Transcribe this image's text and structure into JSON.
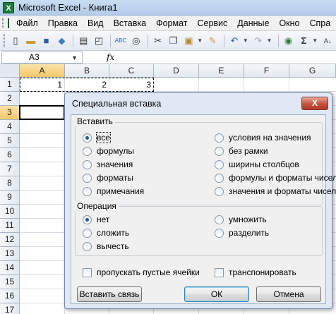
{
  "window": {
    "title": "Microsoft Excel - Книга1"
  },
  "menu": {
    "items": [
      {
        "label": "Файл"
      },
      {
        "label": "Правка"
      },
      {
        "label": "Вид"
      },
      {
        "label": "Вставка"
      },
      {
        "label": "Формат"
      },
      {
        "label": "Сервис"
      },
      {
        "label": "Данные"
      },
      {
        "label": "Окно"
      },
      {
        "label": "Спра"
      }
    ]
  },
  "formula_bar": {
    "name_box": "A3",
    "fx_label": "fx",
    "formula": ""
  },
  "sheet": {
    "columns": [
      "A",
      "B",
      "C",
      "D",
      "E",
      "F",
      "G"
    ],
    "rows": [
      "1",
      "2",
      "3",
      "4",
      "5",
      "6",
      "7",
      "8",
      "9",
      "10",
      "11",
      "12",
      "13",
      "14",
      "15",
      "16",
      "17"
    ],
    "cells": {
      "A1": "1",
      "B1": "2",
      "C1": "3"
    },
    "active_cell": "A3"
  },
  "dialog": {
    "title": "Специальная вставка",
    "close_label": "X",
    "paste_group": {
      "label": "Вставить",
      "options_left": [
        "все",
        "формулы",
        "значения",
        "форматы",
        "примечания"
      ],
      "options_right": [
        "условия на значения",
        "без рамки",
        "ширины столбцов",
        "формулы и форматы чисел",
        "значения и форматы чисел"
      ],
      "selected": "все"
    },
    "operation_group": {
      "label": "Операция",
      "options_left": [
        "нет",
        "сложить",
        "вычесть"
      ],
      "options_right": [
        "умножить",
        "разделить"
      ],
      "selected": "нет"
    },
    "skip_blanks": {
      "label": "пропускать пустые ячейки",
      "checked": false
    },
    "transpose": {
      "label": "транспонировать",
      "checked": false
    },
    "buttons": {
      "paste_link": "Вставить связь",
      "ok": "ОК",
      "cancel": "Отмена"
    }
  }
}
